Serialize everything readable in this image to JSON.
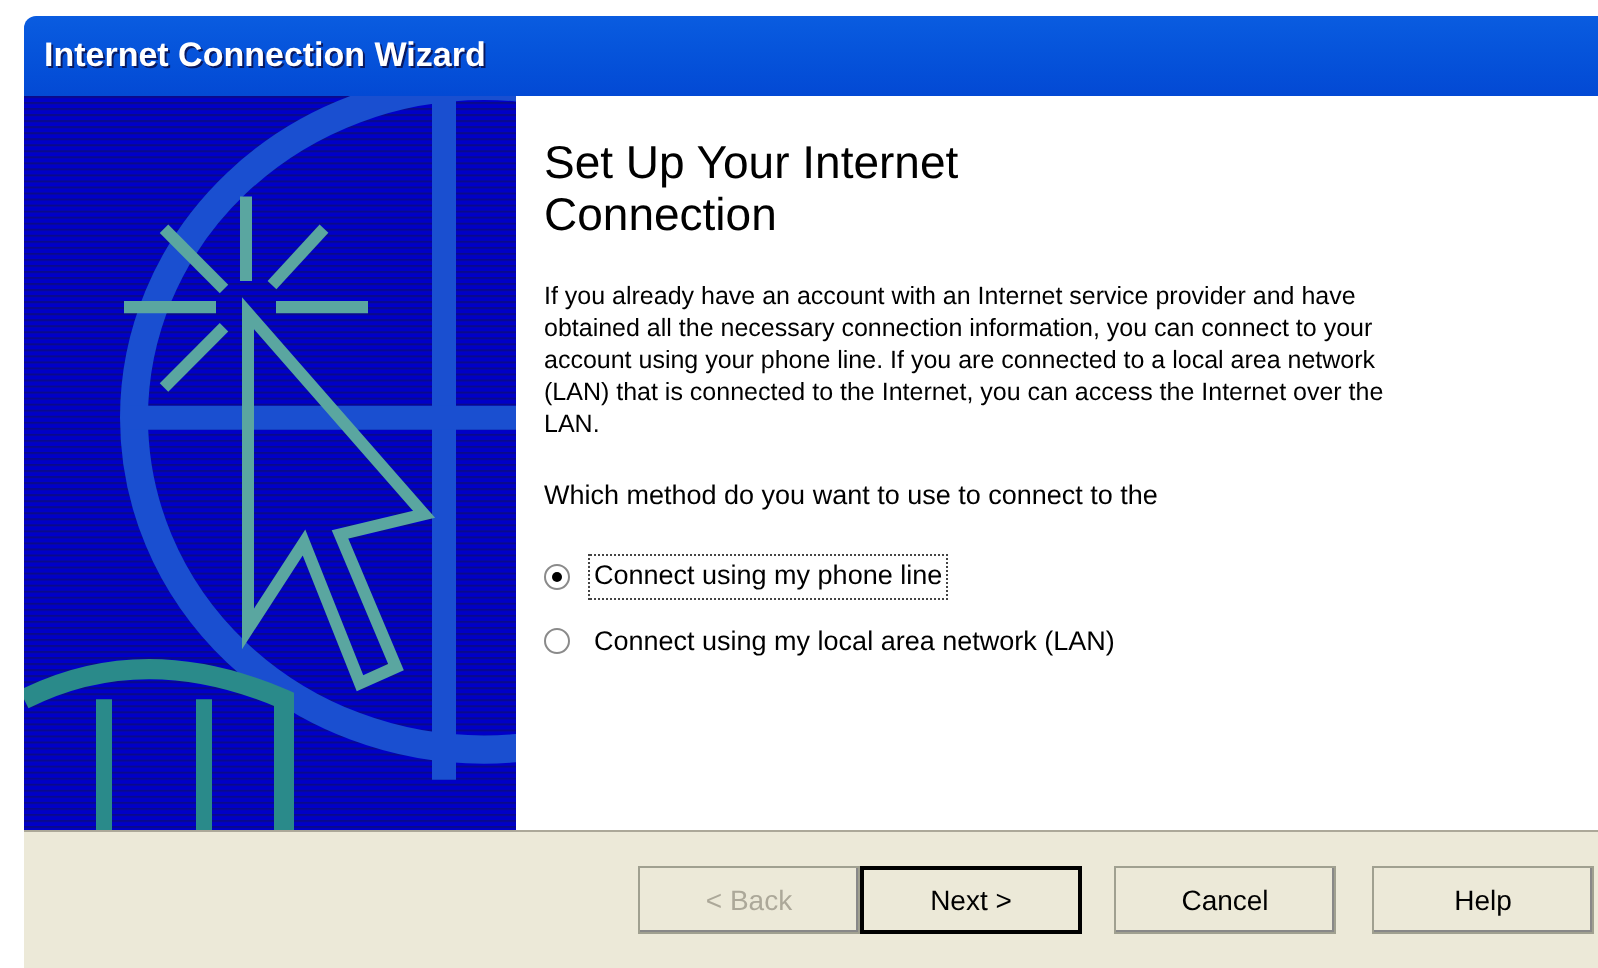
{
  "window": {
    "title": "Internet Connection Wizard"
  },
  "heading": "Set Up Your Internet Connection",
  "description": "If you already have an account with an Internet service provider and have obtained all the necessary connection information, you can connect to your account using your phone line. If you are connected to a local area network (LAN) that is connected to the Internet, you can access the Internet over the LAN.",
  "question": "Which method do you want to use to connect to the",
  "options": [
    {
      "label": "Connect using my phone line",
      "selected": true
    },
    {
      "label": "Connect using my local area network (LAN)",
      "selected": false
    }
  ],
  "buttons": [
    {
      "label": "< Back",
      "disabled": true,
      "default": false
    },
    {
      "label": "Next >",
      "disabled": false,
      "default": true
    },
    {
      "label": "Cancel",
      "disabled": false,
      "default": false
    },
    {
      "label": "Help",
      "disabled": false,
      "default": false
    }
  ]
}
